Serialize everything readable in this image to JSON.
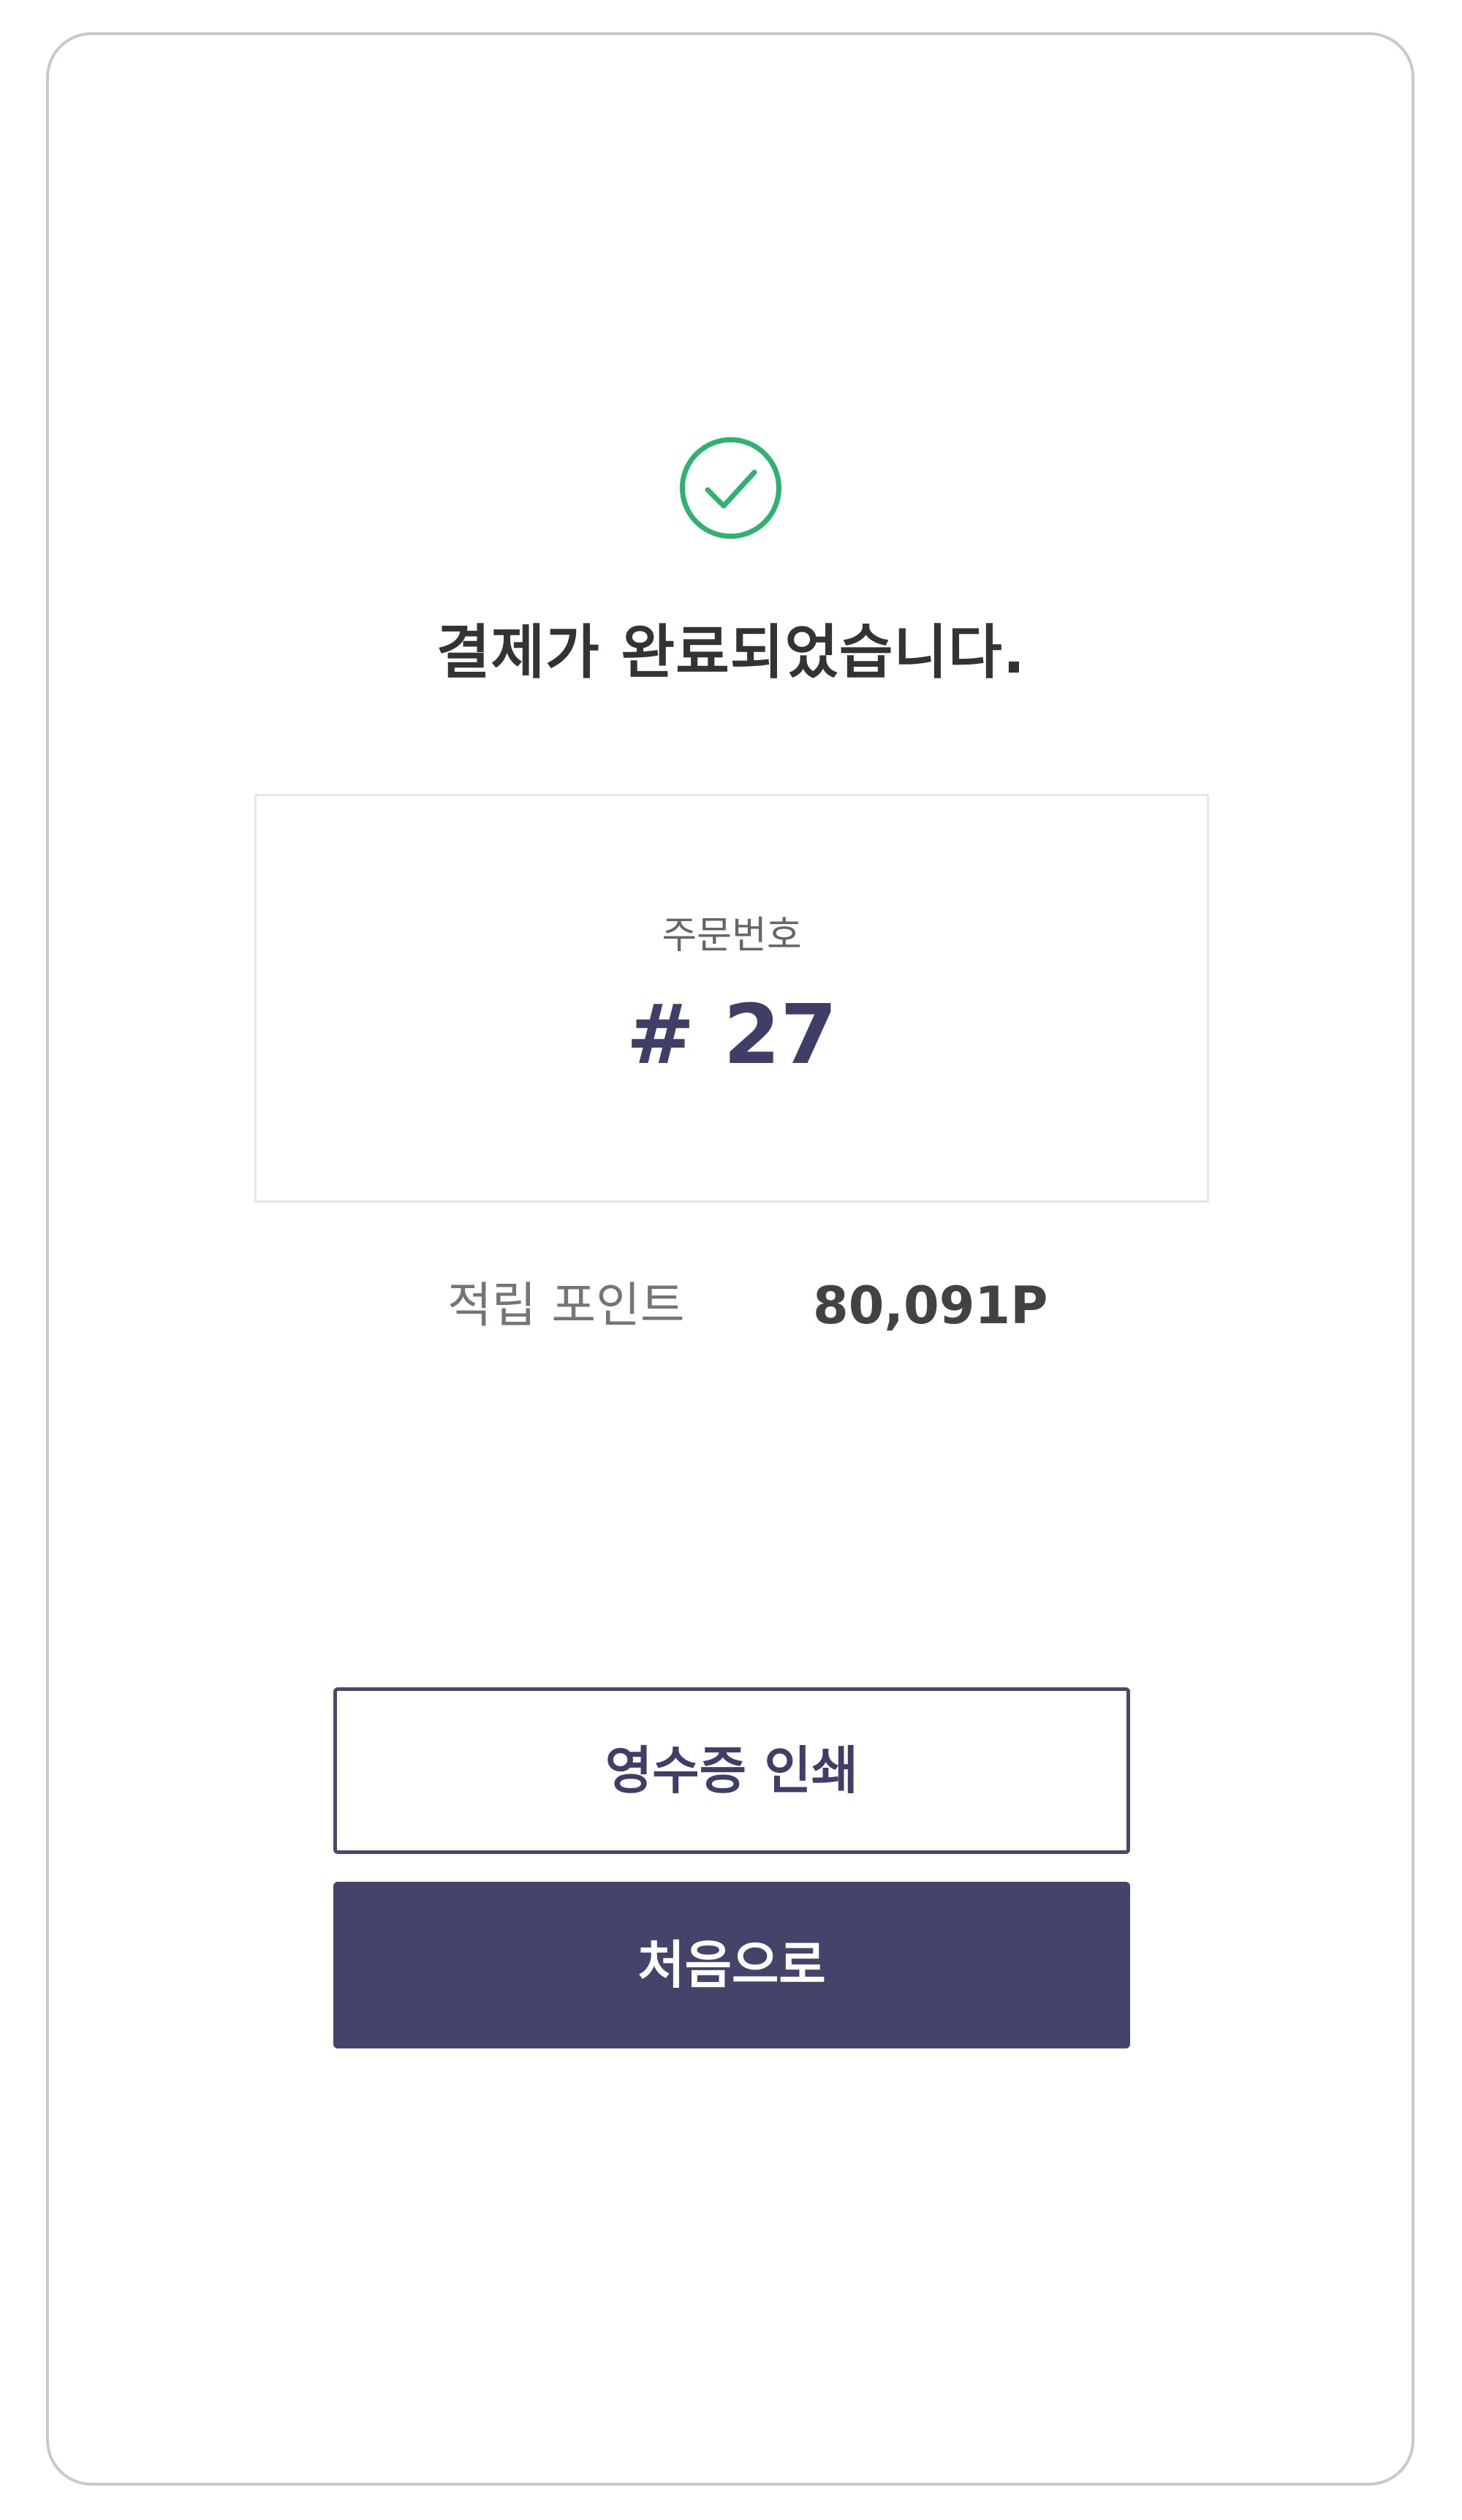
{
  "status": {
    "icon": "check-circle-icon",
    "icon_color": "#2db36f",
    "message": "결제가 완료되었습니다."
  },
  "order": {
    "label": "주문번호",
    "number": "# 27"
  },
  "points": {
    "label": "적립 포인트",
    "value": "80,091P"
  },
  "buttons": {
    "print_label": "영수증 인쇄",
    "home_label": "처음으로"
  },
  "colors": {
    "accent": "#444369",
    "success": "#2db36f"
  }
}
